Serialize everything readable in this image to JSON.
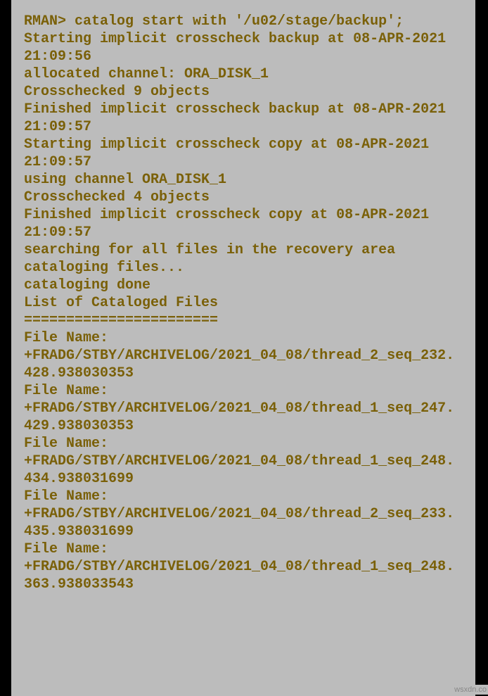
{
  "terminal": {
    "lines": [
      "RMAN> catalog start with '/u02/stage/backup';",
      "",
      "Starting implicit crosscheck backup at 08-APR-2021 21:09:56",
      "allocated channel: ORA_DISK_1",
      "Crosschecked 9 objects",
      "Finished implicit crosscheck backup at 08-APR-2021 21:09:57",
      "",
      "Starting implicit crosscheck copy at 08-APR-2021 21:09:57",
      "using channel ORA_DISK_1",
      "Crosschecked 4 objects",
      "Finished implicit crosscheck copy at 08-APR-2021 21:09:57",
      "",
      "searching for all files in the recovery area",
      "cataloging files...",
      "cataloging done",
      "",
      "List of Cataloged Files",
      "=======================",
      "File Name: +FRADG/STBY/ARCHIVELOG/2021_04_08/thread_2_seq_232.428.938030353",
      "File Name: +FRADG/STBY/ARCHIVELOG/2021_04_08/thread_1_seq_247.429.938030353",
      "File Name: +FRADG/STBY/ARCHIVELOG/2021_04_08/thread_1_seq_248.434.938031699",
      "File Name: +FRADG/STBY/ARCHIVELOG/2021_04_08/thread_2_seq_233.435.938031699",
      "File Name: +FRADG/STBY/ARCHIVELOG/2021_04_08/thread_1_seq_248.363.938033543"
    ]
  },
  "watermark": "wsxdn.co"
}
